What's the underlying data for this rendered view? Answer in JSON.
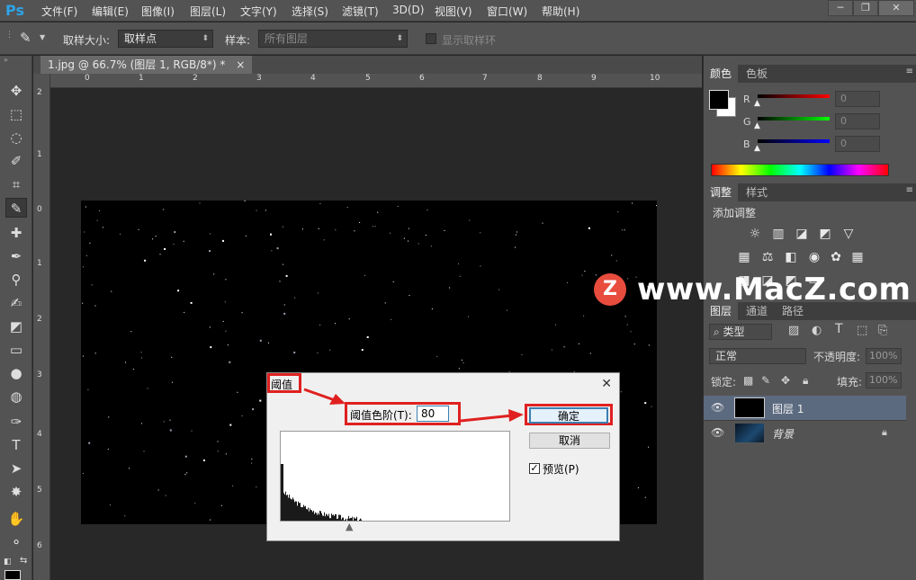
{
  "app": {
    "logo": "Ps"
  },
  "menu": [
    "文件(F)",
    "编辑(E)",
    "图像(I)",
    "图层(L)",
    "文字(Y)",
    "选择(S)",
    "滤镜(T)",
    "3D(D)",
    "视图(V)",
    "窗口(W)",
    "帮助(H)"
  ],
  "window_controls": {
    "minimize": "─",
    "restore": "❐",
    "close": "✕"
  },
  "options": {
    "sample_size_label": "取样大小:",
    "sample_size_value": "取样点",
    "sample_label": "样本:",
    "sample_value": "所有图层",
    "show_ring_label": "显示取样环"
  },
  "document": {
    "tab_title": "1.jpg @ 66.7% (图层 1, RGB/8*) *",
    "tab_close": "×"
  },
  "ruler": {
    "h_ticks": [
      "0",
      "1",
      "2",
      "3",
      "4",
      "5",
      "6",
      "7",
      "8",
      "9",
      "10"
    ],
    "v_ticks": [
      "2",
      "1",
      "0",
      "1",
      "2",
      "3",
      "4",
      "5",
      "6"
    ]
  },
  "color_panel": {
    "tabs": [
      "颜色",
      "色板"
    ],
    "channels": [
      {
        "label": "R",
        "value": "0",
        "color": "#ff0000"
      },
      {
        "label": "G",
        "value": "0",
        "color": "#00ff00"
      },
      {
        "label": "B",
        "value": "0",
        "color": "#0000ff"
      }
    ]
  },
  "adjust_panel": {
    "tabs": [
      "调整",
      "样式"
    ],
    "title": "添加调整"
  },
  "layers_panel": {
    "tabs": [
      "图层",
      "通道",
      "路径"
    ],
    "filter_kind": "类型",
    "blend_mode": "正常",
    "opacity_label": "不透明度:",
    "opacity_value": "100%",
    "lock_label": "锁定:",
    "fill_label": "填充:",
    "fill_value": "100%",
    "layers": [
      {
        "name": "图层 1",
        "selected": true
      },
      {
        "name": "背景",
        "selected": false
      }
    ]
  },
  "threshold_dialog": {
    "title": "阈值",
    "level_label": "阈值色阶(T):",
    "level_value": "80",
    "ok_label": "确定",
    "cancel_label": "取消",
    "preview_label": "预览(P)",
    "preview_checked": true
  },
  "watermark": {
    "logo": "Z",
    "text": "www.MacZ.com"
  },
  "colors": {
    "accent": "#2fa3e8",
    "highlight_red": "#e02020",
    "watermark_red": "#e84c3d"
  }
}
